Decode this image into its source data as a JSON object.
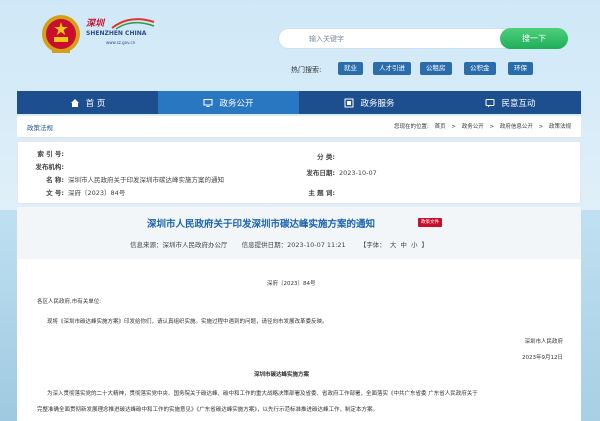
{
  "header": {
    "logo_main": "深圳",
    "logo_sub": "SHENZHEN CHINA",
    "logo_url": "www.sz.gov.cn",
    "search": {
      "placeholder": "输入关键字",
      "button_label": "搜一下"
    },
    "hot_label": "热门搜索:",
    "hot_tags": [
      "就业",
      "人才引进",
      "公租房",
      "公积金",
      "环保"
    ]
  },
  "nav": [
    {
      "label": "首 页",
      "icon": "home-icon"
    },
    {
      "label": "政务公开",
      "icon": "monitor-icon"
    },
    {
      "label": "政务服务",
      "icon": "service-icon"
    },
    {
      "label": "民意互动",
      "icon": "interaction-icon"
    }
  ],
  "breadcrumb": {
    "section": "政策法规",
    "prefix": "您现在的位置:",
    "items": [
      "首页",
      "政务公开",
      "政府信息公开",
      "政策法规"
    ]
  },
  "meta": {
    "index_key": "索 引 号:",
    "index_val": "",
    "publisher_key": "发布机构:",
    "publisher_val": "",
    "name_key": "名 称:",
    "name_val": "深圳市人民政府关于印发深圳市碳达峰实施方案的通知",
    "doc_no_key": "文 号:",
    "doc_no_val": "深府〔2023〕84号",
    "category_key": "分 类:",
    "category_val": "",
    "date_key": "发布日期:",
    "date_val": "2023-10-07",
    "subject_key": "主 题 词:",
    "subject_val": ""
  },
  "doc": {
    "title": "深圳市人民政府关于印发深圳市碳达峰实施方案的通知",
    "badge": "政策文件",
    "source": "信息来源：深圳市人民政府办公厅",
    "time": "信息提供日期：2023-10-07 11:21",
    "font_label": "【字体：",
    "font_large": "大",
    "font_medium": "中",
    "font_small": "小",
    "font_close": "】",
    "doc_number": "深府〔2023〕84号",
    "recipient": "各区人民政府,市有关单位:",
    "body1": "现将《深圳市碳达峰实施方案》印发给你们，请认真组织实施。实施过程中遇到的问题，请径向市发展改革委反映。",
    "signer": "深圳市人民政府",
    "sign_date": "2023年9月12日",
    "section_title": "深圳市碳达峰实施方案",
    "body2": "为深入贯彻落实党的二十大精神，贯彻落实党中央、国务院关于碳达峰、碳中和工作的重大战略决策部署及省委、省政府工作部署，全面落实《中共广东省委 广东省人民政府关于",
    "body3": "完整准确全面贯彻新发展理念推进碳达峰碳中和工作的实施意见》《广东省碳达峰实施方案》，以先行示范标准推进碳达峰工作，制定本方案。"
  }
}
